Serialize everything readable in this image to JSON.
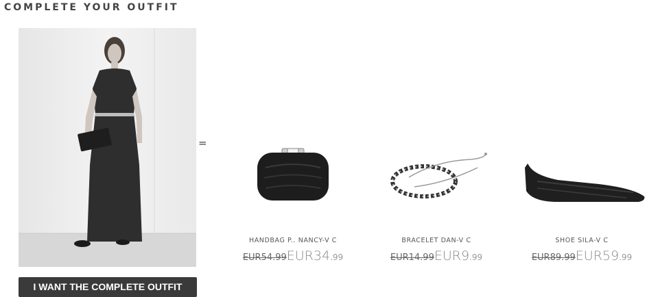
{
  "section": {
    "title": "COMPLETE YOUR OUTFIT"
  },
  "outfit_button": {
    "label": "I WANT THE COMPLETE OUTFIT"
  },
  "equals_sign": "=",
  "products": [
    {
      "name": "HANDBAG P.. NANCY-V C",
      "old_price": "EUR54.99",
      "new_price_main": "EUR34",
      "new_price_cents": ".99",
      "icon": "handbag-icon"
    },
    {
      "name": "BRACELET DAN-V C",
      "old_price": "EUR14.99",
      "new_price_main": "EUR9",
      "new_price_cents": ".99",
      "icon": "bracelet-icon"
    },
    {
      "name": "SHOE SILA-V C",
      "old_price": "EUR89.99",
      "new_price_main": "EUR59",
      "new_price_cents": ".99",
      "icon": "shoe-icon"
    }
  ]
}
